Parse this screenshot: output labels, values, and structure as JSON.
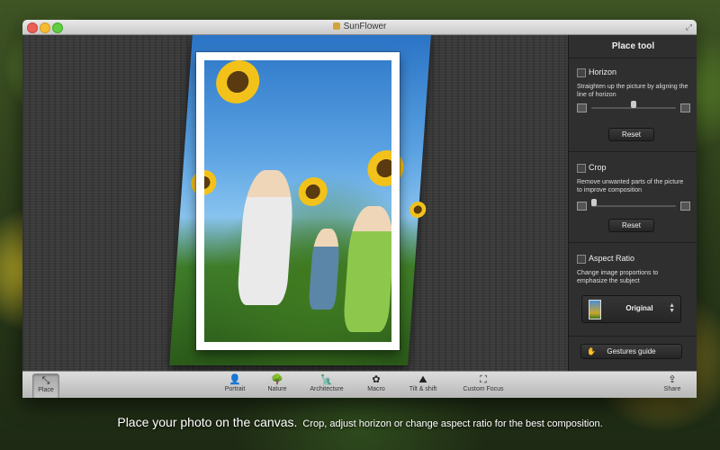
{
  "window": {
    "title": "SunFlower"
  },
  "panel": {
    "title": "Place tool",
    "horizon": {
      "label": "Horizon",
      "description": "Straighten up the picture by aligning the line of horizon",
      "reset": "Reset",
      "slider_value": 0.5
    },
    "crop": {
      "label": "Crop",
      "description": "Remove unwanted parts of the picture to improve composition",
      "reset": "Reset",
      "slider_value": 0.0
    },
    "aspect": {
      "label": "Aspect Ratio",
      "description": "Change image proportions to emphasize the subject",
      "selected": "Original"
    },
    "gestures_button": "Gestures guide"
  },
  "toolbar": {
    "place": "Place",
    "portrait": "Portrait",
    "nature": "Nature",
    "architecture": "Architecture",
    "macro": "Macro",
    "tilt_shift": "Tilt & shift",
    "custom_focus": "Custom Focus",
    "share": "Share"
  },
  "caption": {
    "headline": "Place your photo on the canvas.",
    "subline": "Crop, adjust horizon or change aspect ratio for the best composition."
  },
  "icons": {
    "place": "move-arrows-icon",
    "portrait": "person-icon",
    "nature": "tree-icon",
    "architecture": "statue-icon",
    "macro": "flower-icon",
    "tilt_shift": "tilt-shift-icon",
    "custom_focus": "focus-frame-icon",
    "share": "share-arrow-icon"
  }
}
